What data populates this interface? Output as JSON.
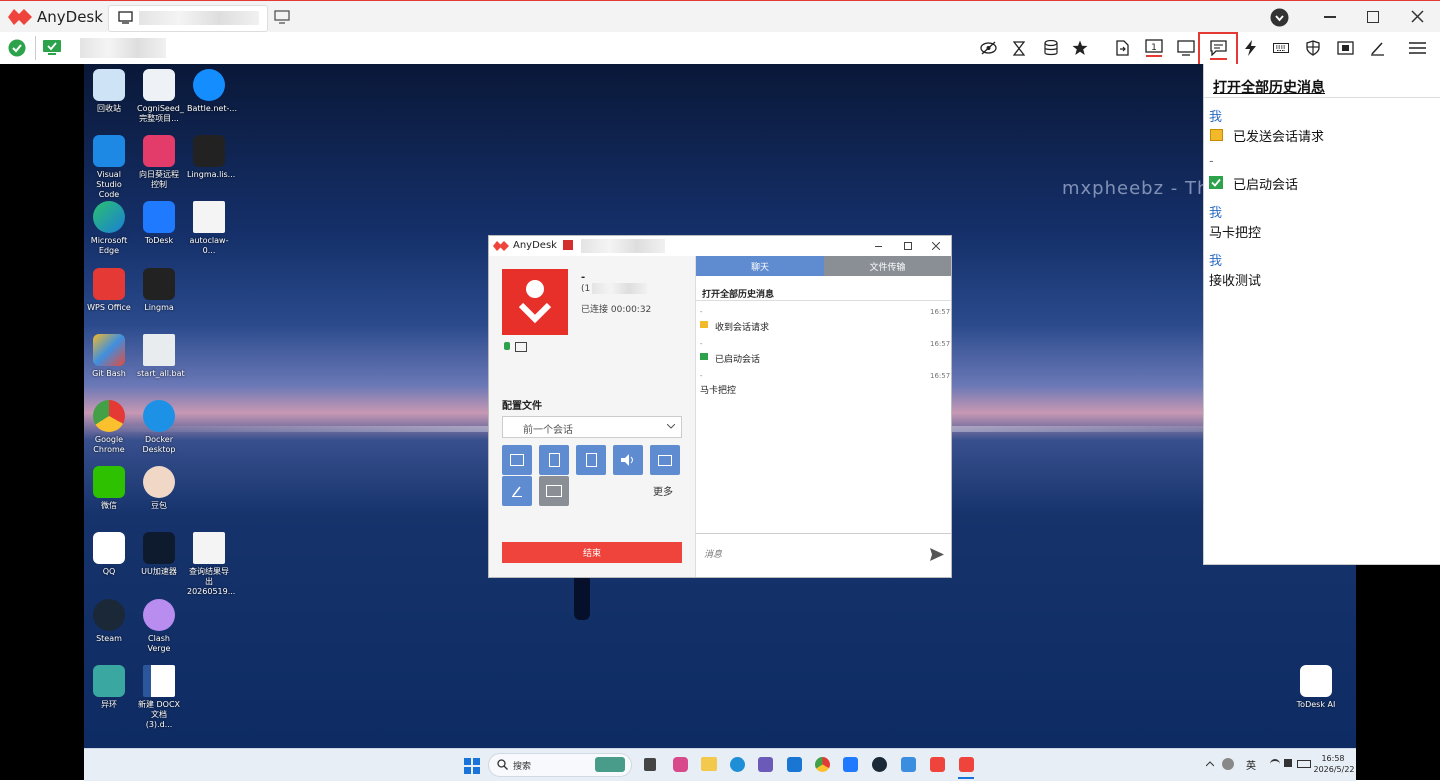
{
  "app": {
    "title": "AnyDesk"
  },
  "colors": {
    "brand": "#ef443b",
    "accent": "#5f8bd0",
    "highlight": "#e53935"
  },
  "toolbar": {
    "icons": [
      "eye-off-icon",
      "hourglass-icon",
      "database-icon",
      "star-icon",
      "file-transfer-icon",
      "monitor-1-icon",
      "display-icon",
      "chat-icon",
      "lightning-icon",
      "keyboard-icon",
      "shield-icon",
      "screenshot-icon",
      "pen-icon",
      "menu-icon"
    ]
  },
  "desktop": {
    "watermark": "mxpheebz - Th",
    "icons": [
      {
        "label": "回收站"
      },
      {
        "label": "CogniSeed_ 完整项目..."
      },
      {
        "label": "Battle.net-..."
      },
      {
        "label": "Visual Studio Code"
      },
      {
        "label": "向日葵远程控制"
      },
      {
        "label": "Lingma.lis..."
      },
      {
        "label": "Microsoft Edge"
      },
      {
        "label": "ToDesk"
      },
      {
        "label": "autoclaw-0..."
      },
      {
        "label": "WPS Office"
      },
      {
        "label": "Lingma"
      },
      {
        "label": "Git Bash"
      },
      {
        "label": "start_all.bat"
      },
      {
        "label": "Google Chrome"
      },
      {
        "label": "Docker Desktop"
      },
      {
        "label": "微信"
      },
      {
        "label": "豆包"
      },
      {
        "label": "QQ"
      },
      {
        "label": "UU加速器"
      },
      {
        "label": "查询结果导出 20260519..."
      },
      {
        "label": "Steam"
      },
      {
        "label": "Clash Verge"
      },
      {
        "label": "异环"
      },
      {
        "label": "新建 DOCX 文档 (3).d..."
      },
      {
        "label": "ToDesk AI"
      }
    ],
    "taskbar": {
      "search": "搜索",
      "lang": "英",
      "time": "16:58",
      "date": "2026/5/22"
    }
  },
  "inner": {
    "title": "AnyDesk",
    "dash": "-",
    "id_prefix": "(1",
    "connected": "已连接 00:00:32",
    "profile_label": "配置文件",
    "profile_value": "前一个会话",
    "more": "更多",
    "end_button": "结束",
    "tab_chat": "聊天",
    "tab_files": "文件传输",
    "history_link": "打开全部历史消息",
    "messages": [
      {
        "sender": "-",
        "time": "16:57",
        "text": "收到会话请求"
      },
      {
        "sender": "-",
        "time": "16:57",
        "text": "已启动会话"
      },
      {
        "sender": "-",
        "time": "16:57",
        "text": "马卡把控"
      }
    ],
    "input_placeholder": "消息"
  },
  "chat": {
    "history_link": "打开全部历史消息",
    "messages": [
      {
        "sender": "我",
        "text": "已发送会话请求"
      },
      {
        "sender": "-",
        "text": "已启动会话"
      },
      {
        "sender": "我",
        "text": "马卡把控"
      },
      {
        "sender": "我",
        "text": "接收测试"
      }
    ]
  }
}
